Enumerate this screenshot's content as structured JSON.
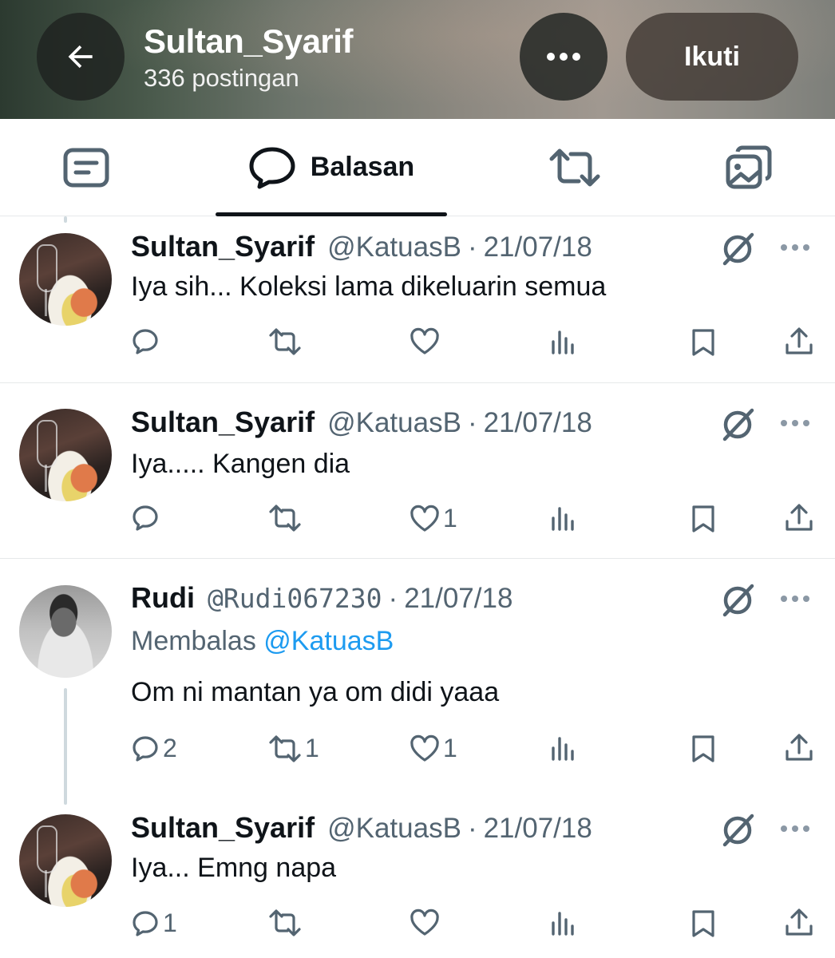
{
  "header": {
    "name": "Sultan_Syarif",
    "post_count": "336 postingan",
    "follow_label": "Ikuti"
  },
  "tabs": {
    "active_label": "Balasan"
  },
  "posts": [
    {
      "name": "Sultan_Syarif",
      "handle": "@KatuasB",
      "date": "21/07/18",
      "text": "Iya sih... Koleksi lama dikeluarin semua",
      "replies": "",
      "reposts": "",
      "likes": ""
    },
    {
      "name": "Sultan_Syarif",
      "handle": "@KatuasB",
      "date": "21/07/18",
      "text": "Iya..... Kangen dia",
      "replies": "",
      "reposts": "",
      "likes": "1"
    },
    {
      "name": "Rudi",
      "handle": "@Rudi067230",
      "date": "21/07/18",
      "reply_prefix": "Membalas",
      "reply_mention": "@KatuasB",
      "text": "Om ni mantan ya om didi yaaa",
      "replies": "2",
      "reposts": "1",
      "likes": "1"
    },
    {
      "name": "Sultan_Syarif",
      "handle": "@KatuasB",
      "date": "21/07/18",
      "text": "Iya... Emng napa",
      "replies": "1",
      "reposts": "",
      "likes": ""
    }
  ],
  "separator": "·",
  "icons": {
    "back": "arrow-left-icon",
    "more": "more-dots-icon",
    "posts_tab": "posts-tab-icon",
    "replies_tab": "speech-bubble-icon",
    "reposts_tab": "repost-icon",
    "media_tab": "media-icon",
    "grok": "grok-icon",
    "reply": "reply-icon",
    "repost": "repost-icon",
    "like": "heart-icon",
    "views": "views-icon",
    "bookmark": "bookmark-icon",
    "share": "share-icon"
  },
  "colors": {
    "text": "#0f1419",
    "secondary": "#536471",
    "link": "#1d9bf0",
    "border": "#e6e9ea"
  }
}
